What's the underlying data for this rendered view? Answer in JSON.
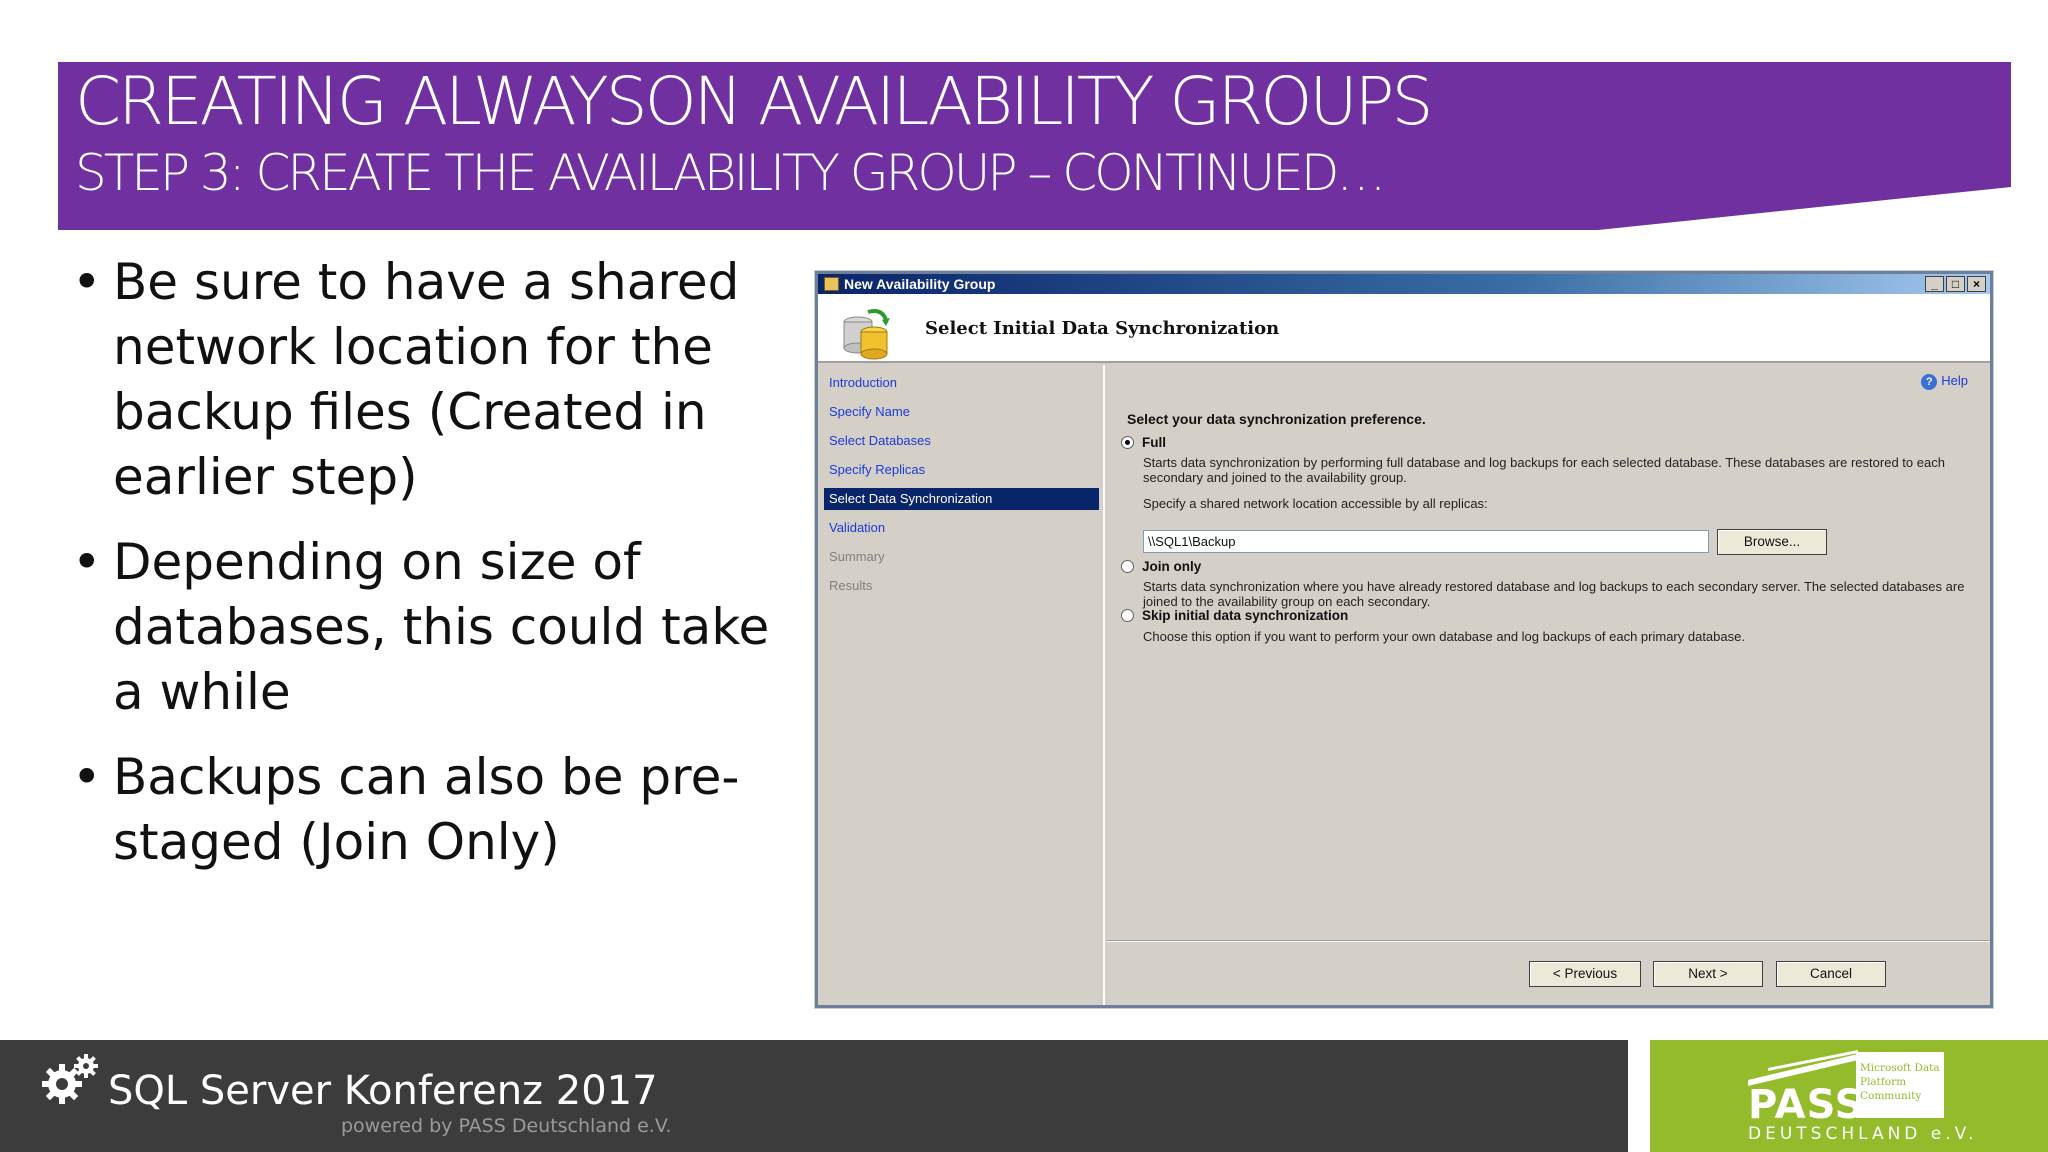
{
  "slide": {
    "title": "CREATING ALWAYSON AVAILABILITY GROUPS",
    "subtitle": "STEP 3: CREATE THE AVAILABILITY GROUP – CONTINUED…",
    "bullets": [
      "Be sure to have a shared network location for the backup files (Created in earlier step)",
      "Depending on size of databases, this could take a while",
      "Backups can also be pre-staged (Join Only)"
    ],
    "bullet_glyph": "•",
    "brand_color": "#7030a0"
  },
  "dialog": {
    "window_title": "New Availability Group",
    "window_buttons": [
      "_",
      "□",
      "×"
    ],
    "page_title": "Select Initial Data Synchronization",
    "nav": [
      {
        "label": "Introduction",
        "state": "link"
      },
      {
        "label": "Specify Name",
        "state": "link"
      },
      {
        "label": "Select Databases",
        "state": "link"
      },
      {
        "label": "Specify Replicas",
        "state": "link"
      },
      {
        "label": "Select Data Synchronization",
        "state": "active"
      },
      {
        "label": "Validation",
        "state": "link"
      },
      {
        "label": "Summary",
        "state": "disabled"
      },
      {
        "label": "Results",
        "state": "disabled"
      }
    ],
    "help_label": "Help",
    "preference_label": "Select your data synchronization preference.",
    "options": {
      "full": {
        "label": "Full",
        "selected": true,
        "description": "Starts data synchronization by performing full database and log backups for each selected database. These databases are restored to each secondary and joined to the availability group.",
        "share_label": "Specify a shared network location accessible by all replicas:",
        "share_value": "\\\\SQL1\\Backup",
        "browse_label": "Browse..."
      },
      "join_only": {
        "label": "Join only",
        "selected": false,
        "description": "Starts data synchronization where you have already restored database and log backups to each secondary server. The selected databases are joined to the availability group on each secondary."
      },
      "skip": {
        "label": "Skip initial data synchronization",
        "selected": false,
        "description": "Choose this option if you want to perform your own database and log backups of each primary database."
      }
    },
    "buttons": {
      "previous": "< Previous",
      "next": "Next >",
      "cancel": "Cancel"
    }
  },
  "footer": {
    "conference": "SQL Server Konferenz 2017",
    "powered_by": "powered by PASS Deutschland e.V.",
    "logo_word": "PASS",
    "logo_tagline": "Microsoft Data Platform Community",
    "logo_region": "DEUTSCHLAND e.V.",
    "logo_color": "#93bb2b"
  }
}
